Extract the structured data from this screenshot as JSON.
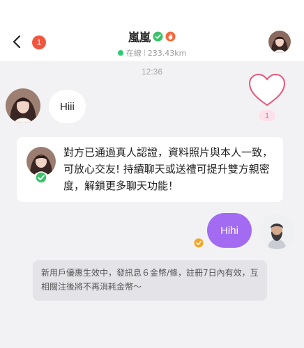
{
  "header": {
    "unread_count": "1",
    "peer_name": "嵐嵐",
    "online_status": "在線",
    "distance": "233.43km"
  },
  "chat": {
    "timestamp": "12:36",
    "incoming_message": "Hiii",
    "heart_count": "1",
    "verification_notice": "對方已通過真人認證，資料照片與本人一致，可放心交友! 持續聊天或送禮可提升雙方親密度，解鎖更多聊天功能！",
    "outgoing_message": "Hihi",
    "system_note": "新用戶優惠生效中，發訊息６金幣/條，註冊7日內有效，互相關注後將不再消耗金幣～"
  },
  "colors": {
    "accent_purple": "#a26bf2",
    "badge_red": "#f2553d",
    "online_green": "#2ecc71",
    "heart_pink": "#e9577a"
  },
  "icons": [
    "back-icon",
    "verified-icon",
    "fire-icon",
    "heart-icon",
    "coin-icon",
    "default-avatar-icon"
  ]
}
